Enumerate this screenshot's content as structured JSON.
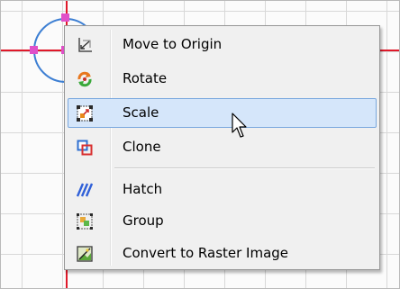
{
  "context_menu": {
    "items": [
      {
        "label": "Move to Origin",
        "icon": "move-to-origin-icon"
      },
      {
        "label": "Rotate",
        "icon": "rotate-icon"
      },
      {
        "label": "Scale",
        "icon": "scale-icon",
        "highlighted": true
      },
      {
        "label": "Clone",
        "icon": "clone-icon"
      },
      {
        "label": "Hatch",
        "icon": "hatch-icon"
      },
      {
        "label": "Group",
        "icon": "group-icon"
      },
      {
        "label": "Convert to Raster Image",
        "icon": "convert-to-raster-icon"
      }
    ]
  },
  "colors": {
    "axis": "#e0192a",
    "selection_grip": "#e050c8",
    "shape_outline": "#3d7fd3",
    "menu_highlight": "#d5e6fa",
    "menu_highlight_border": "#7aa8de"
  }
}
